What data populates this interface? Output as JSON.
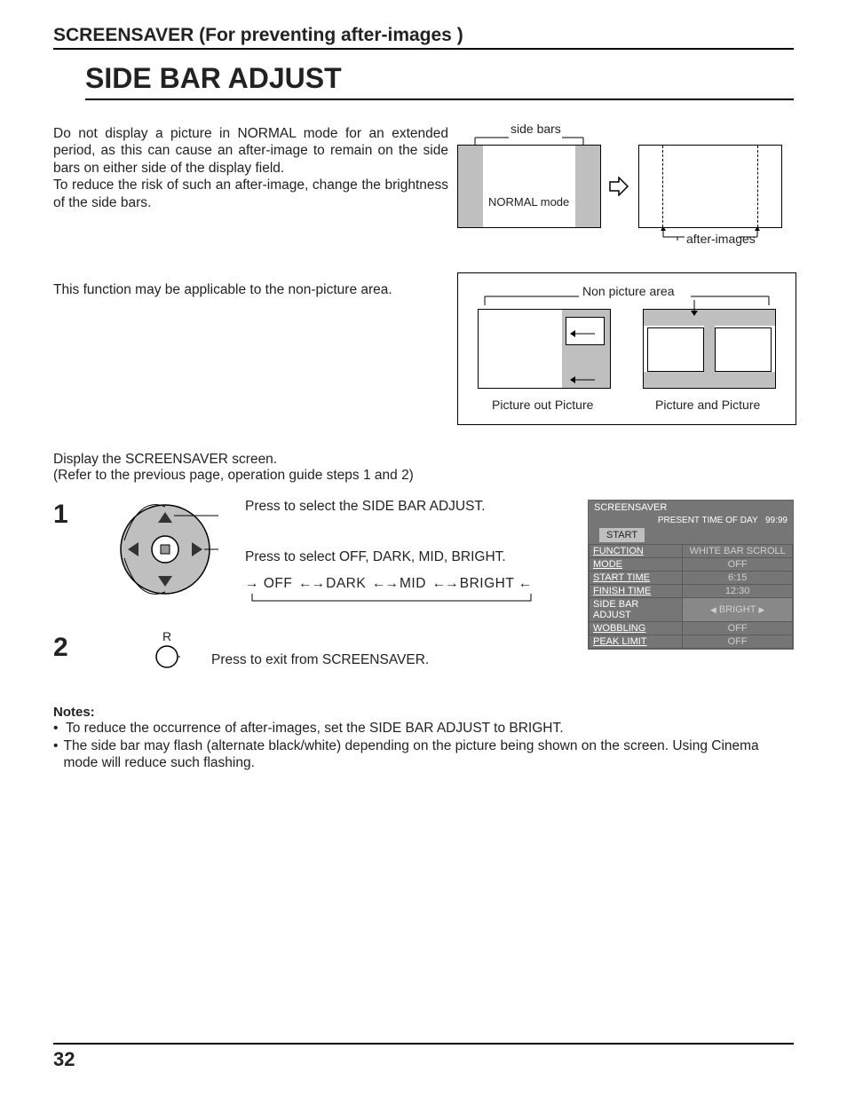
{
  "section_head": "SCREENSAVER (For preventing after-images )",
  "page_title": "SIDE BAR ADJUST",
  "intro_p1": "Do not display a picture in NORMAL mode for an extended period, as this can cause an after-image to remain on the side bars on either side of the display field.",
  "intro_p2": "To reduce the risk of such an after-image, change the brightness of the side bars.",
  "note_applicable": "This function may be applicable to the non-picture area.",
  "diagA": {
    "side_bars": "side bars",
    "normal_mode": "NORMAL mode",
    "after_images": "after-images"
  },
  "diagB": {
    "non_picture": "Non picture area",
    "pop": "Picture out Picture",
    "pap": "Picture and Picture"
  },
  "display_instr_l1": "Display the SCREENSAVER screen.",
  "display_instr_l2": "(Refer to the previous page, operation guide steps 1 and 2)",
  "step1": {
    "num": "1",
    "line1": "Press to select the SIDE BAR ADJUST.",
    "line2": "Press to select OFF, DARK, MID, BRIGHT.",
    "cycle": {
      "off": "OFF",
      "dark": "DARK",
      "mid": "MID",
      "bright": "BRIGHT"
    }
  },
  "step2": {
    "num": "2",
    "r": "R",
    "line": "Press to exit from SCREENSAVER."
  },
  "osd": {
    "title": "SCREENSAVER",
    "present_time": "PRESENT  TIME OF DAY",
    "present_val": "99:99",
    "start": "START",
    "rows": [
      {
        "label": "FUNCTION",
        "value": "WHITE BAR SCROLL",
        "u": true
      },
      {
        "label": "MODE",
        "value": "OFF",
        "u": true
      },
      {
        "label": "START TIME",
        "value": "6:15",
        "u": true
      },
      {
        "label": "FINISH TIME",
        "value": "12:30",
        "u": true
      },
      {
        "label": "SIDE BAR ADJUST",
        "value": "BRIGHT",
        "u": false,
        "hi": true
      },
      {
        "label": "WOBBLING",
        "value": "OFF",
        "u": true
      },
      {
        "label": "PEAK LIMIT",
        "value": "OFF",
        "u": true
      }
    ]
  },
  "notes_head": "Notes:",
  "notes": [
    "To reduce the occurrence of after-images, set the SIDE BAR ADJUST to BRIGHT.",
    "The side bar may flash (alternate black/white) depending on the picture being shown on the screen. Using Cinema mode will reduce such flashing."
  ],
  "page_num": "32"
}
